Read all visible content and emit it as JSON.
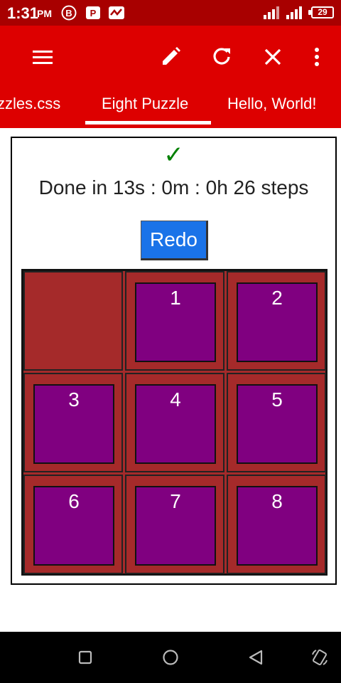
{
  "status_bar": {
    "time": "1:31",
    "ampm": "PM",
    "battery": "29",
    "icons": [
      "b-circle-icon",
      "p-app-icon",
      "activity-icon",
      "signal-icon",
      "signal-icon",
      "battery-icon"
    ]
  },
  "toolbar": {
    "icons": [
      "menu-icon",
      "pencil-icon",
      "refresh-icon",
      "close-icon",
      "more-vert-icon"
    ],
    "tabs": [
      "zzles.css",
      "Eight Puzzle",
      "Hello, World!"
    ],
    "active_tab": "Eight Puzzle"
  },
  "puzzle": {
    "check": "✓",
    "status": "Done in 13s : 0m : 0h 26 steps",
    "redo_label": "Redo",
    "tiles": [
      "",
      "1",
      "2",
      "3",
      "4",
      "5",
      "6",
      "7",
      "8"
    ]
  },
  "colors": {
    "status_bar": "#a80000",
    "toolbar": "#dd0000",
    "cell": "#a52a2a",
    "tile": "#800080",
    "redo": "#1a73e8",
    "check": "#008000"
  },
  "nav_bar": {
    "icons": [
      "square-icon",
      "circle-icon",
      "triangle-back-icon",
      "rotate-icon"
    ]
  }
}
